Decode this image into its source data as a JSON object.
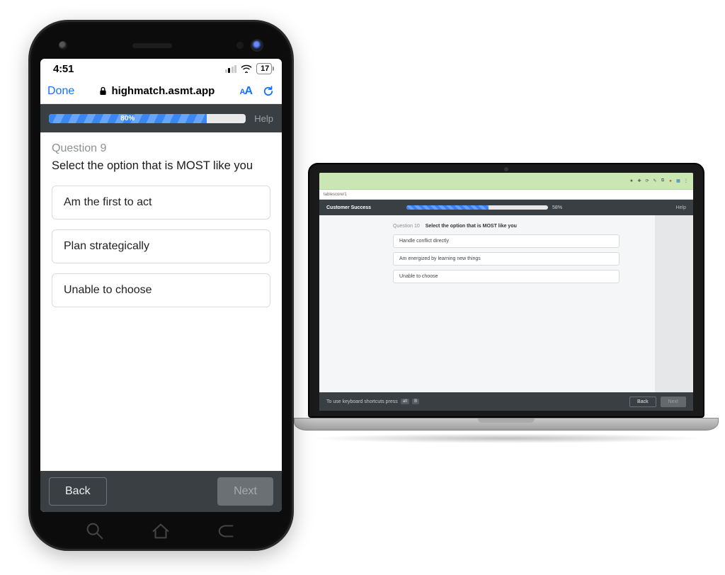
{
  "phone": {
    "status": {
      "time": "4:51",
      "battery_text": "17"
    },
    "safari": {
      "done_label": "Done",
      "url": "highmatch.asmt.app",
      "aa_label": "AA"
    },
    "progress": {
      "percent": 80,
      "label": "80%",
      "help_label": "Help"
    },
    "question": {
      "number_label": "Question 9",
      "prompt": "Select the option that is MOST like you",
      "options": [
        "Am the first to act",
        "Plan strategically",
        "Unable to choose"
      ]
    },
    "footer": {
      "back_label": "Back",
      "next_label": "Next"
    }
  },
  "laptop": {
    "url": "tablescore/1",
    "app_title": "Customer Success",
    "progress": {
      "percent": 58,
      "label": "58%",
      "help_label": "Help"
    },
    "question": {
      "number_label": "Question 10",
      "prompt": "Select the option that is MOST like you",
      "options": [
        "Handle conflict directly",
        "Am energized by learning new things",
        "Unable to choose"
      ]
    },
    "footer": {
      "shortcut_hint": "To use keyboard shortcuts press",
      "shortcut_keys": [
        "alt",
        "B"
      ],
      "back_label": "Back",
      "next_label": "Next"
    }
  }
}
